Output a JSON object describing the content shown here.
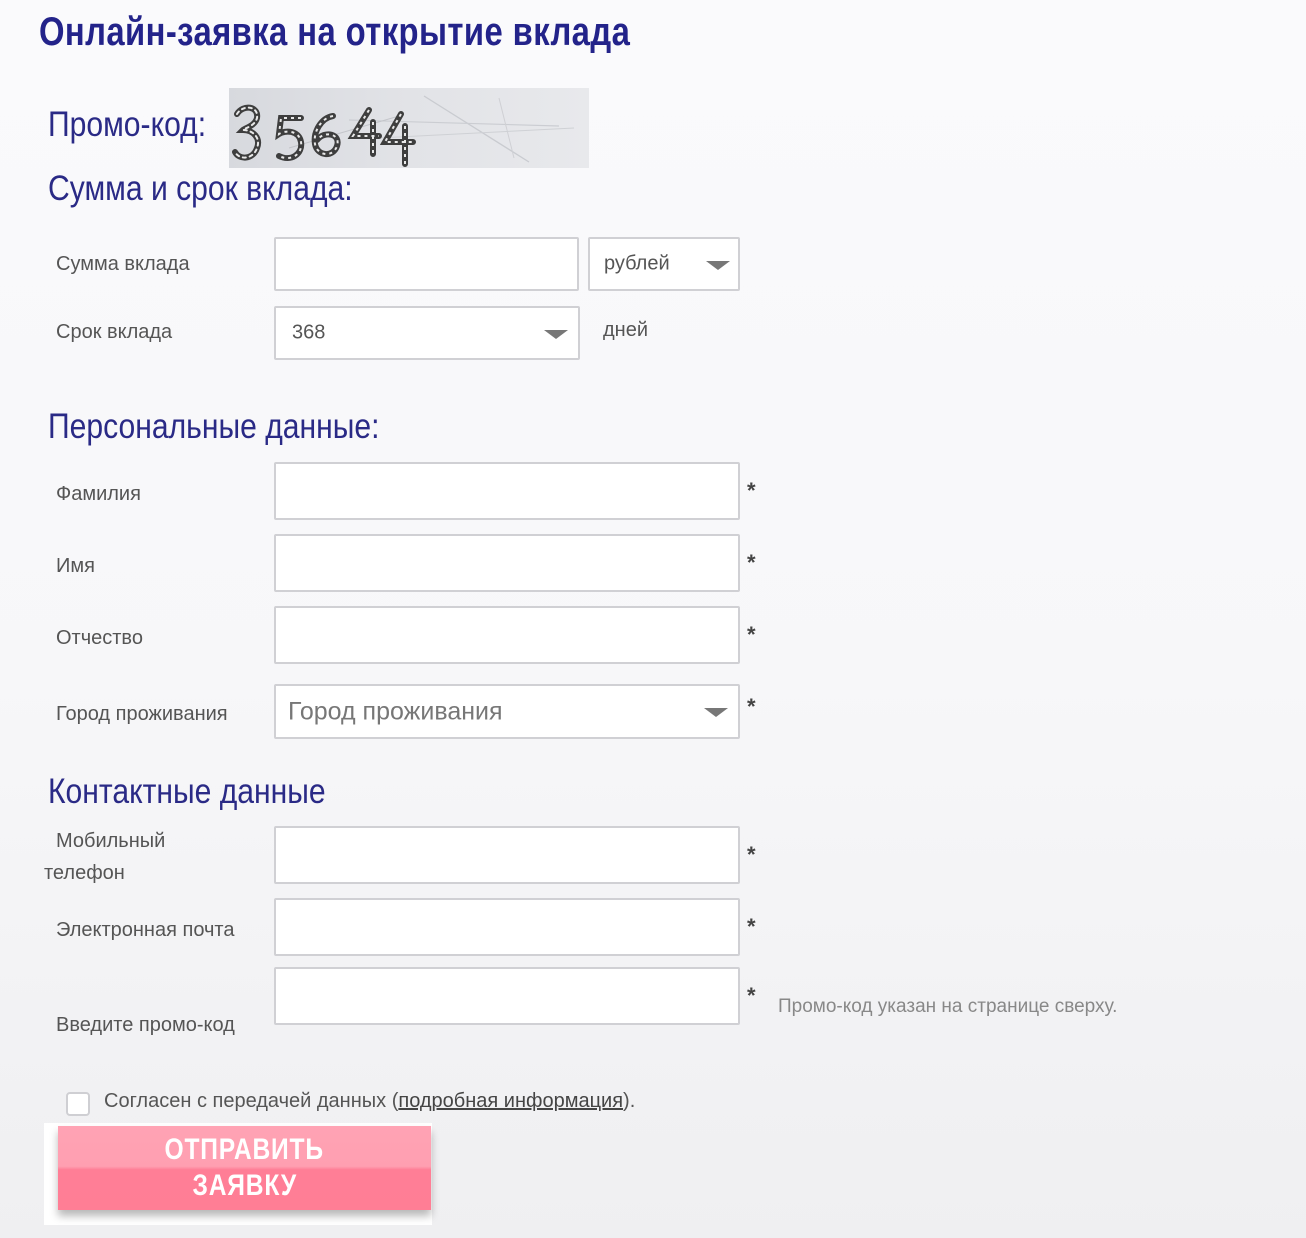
{
  "page": {
    "title": "Онлайн-заявка на открытие вклада"
  },
  "promo": {
    "label": "Промо-код:",
    "captcha_code": "35644"
  },
  "sections": {
    "deposit": "Сумма и срок вклада:",
    "personal": "Персональные данные:",
    "contacts": "Контактные данные"
  },
  "deposit": {
    "amount_label": "Сумма вклада",
    "amount_value": "",
    "currency_selected": "рублей",
    "term_label": "Срок вклада",
    "term_selected": "368",
    "term_unit": "дней"
  },
  "personal": {
    "lastname_label": "Фамилия",
    "firstname_label": "Имя",
    "patronymic_label": "Отчество",
    "city_label": "Город проживания",
    "city_placeholder": "Город проживания"
  },
  "contacts": {
    "phone_label_line1": "Мобильный",
    "phone_label_line2": "телефон",
    "email_label": "Электронная почта",
    "promo_input_label": "Введите промо-код",
    "promo_hint": "Промо-код указан на странице сверху."
  },
  "required_mark": "*",
  "consent": {
    "checked": false,
    "text_before": "Согласен с передачей данных (",
    "link_text": "подробная информация",
    "text_after": ")."
  },
  "submit": {
    "line1": "ОТПРАВИТЬ",
    "line2": "ЗАЯВКУ"
  },
  "colors": {
    "heading": "#2a2a86",
    "title": "#23238a",
    "button_top": "#ffa3b4",
    "button_bottom": "#ff7e96"
  }
}
